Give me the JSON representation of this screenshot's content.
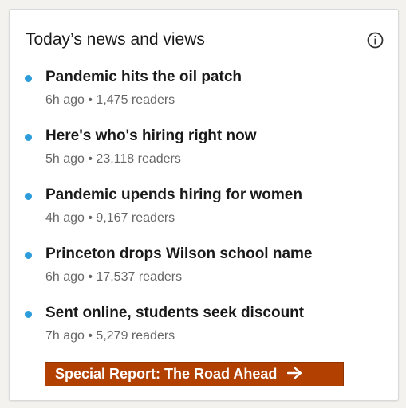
{
  "header": {
    "title": "Today’s news and views",
    "info_icon": "info-circle-icon"
  },
  "news": [
    {
      "headline": "Pandemic hits the oil patch",
      "meta": "6h ago • 1,475 readers"
    },
    {
      "headline": "Here's who's hiring right now",
      "meta": "5h ago • 23,118 readers"
    },
    {
      "headline": "Pandemic upends hiring for women",
      "meta": "4h ago • 9,167 readers"
    },
    {
      "headline": "Princeton drops Wilson school name",
      "meta": "6h ago • 17,537 readers"
    },
    {
      "headline": "Sent online, students seek discount",
      "meta": "7h ago • 5,279 readers"
    }
  ],
  "special_report": {
    "label": "Special Report: The Road Ahead",
    "icon": "arrow-right-icon"
  },
  "colors": {
    "bullet": "#2d9cdb",
    "special_report_bg": "#b24000",
    "card_bg": "#ffffff"
  }
}
